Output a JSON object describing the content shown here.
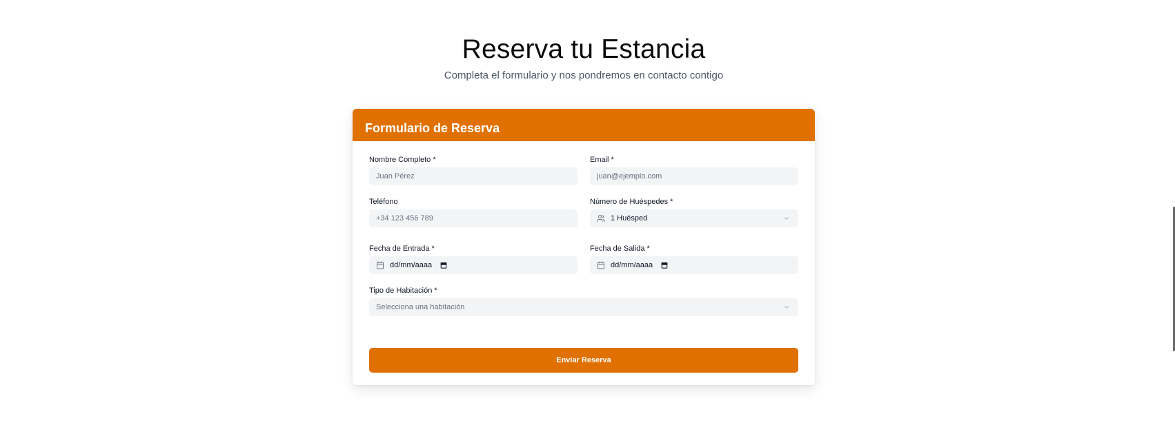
{
  "colors": {
    "accent": "#e07000"
  },
  "hero": {
    "title": "Reserva tu Estancia",
    "subtitle": "Completa el formulario y nos pondremos en contacto contigo"
  },
  "form": {
    "title": "Formulario de Reserva",
    "name": {
      "label": "Nombre Completo *",
      "placeholder": "Juan Pérez"
    },
    "email": {
      "label": "Email *",
      "placeholder": "juan@ejemplo.com"
    },
    "phone": {
      "label": "Teléfono",
      "placeholder": "+34 123 456 789"
    },
    "guests": {
      "label": "Número de Huéspedes *",
      "value": "1 Huésped",
      "icon": "users-icon"
    },
    "checkin": {
      "label": "Fecha de Entrada *",
      "value": "dd/mm/aaaa",
      "icon": "calendar-icon"
    },
    "checkout": {
      "label": "Fecha de Salida *",
      "value": "dd/mm/aaaa",
      "icon": "calendar-icon"
    },
    "room_type": {
      "label": "Tipo de Habitación *",
      "placeholder": "Selecciona una habitación"
    },
    "submit_label": "Enviar Reserva"
  }
}
